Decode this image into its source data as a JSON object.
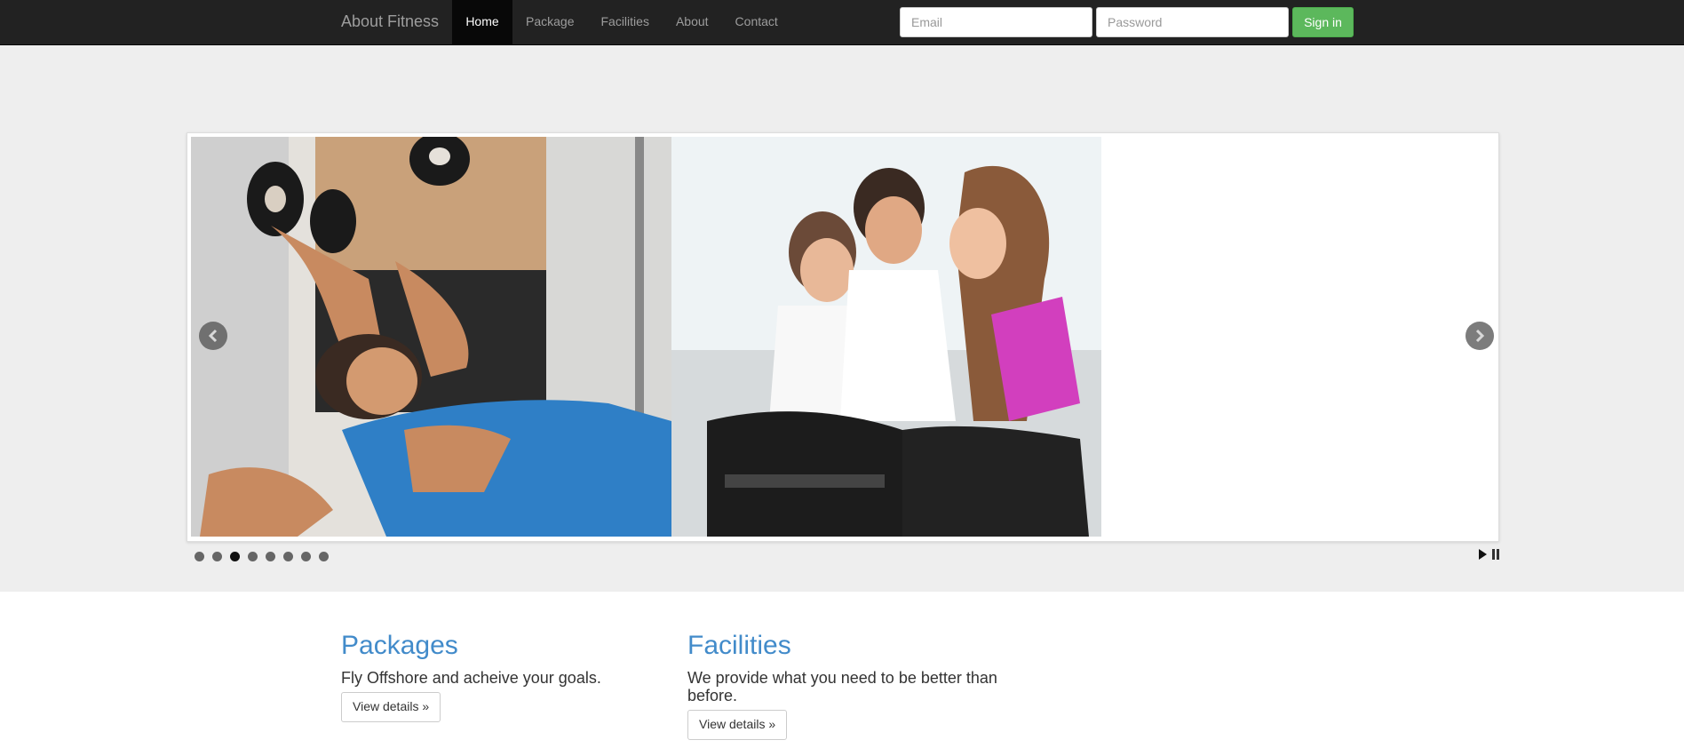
{
  "navbar": {
    "brand": "About Fitness",
    "items": [
      {
        "label": "Home",
        "active": true
      },
      {
        "label": "Package",
        "active": false
      },
      {
        "label": "Facilities",
        "active": false
      },
      {
        "label": "About",
        "active": false
      },
      {
        "label": "Contact",
        "active": false
      }
    ],
    "email_placeholder": "Email",
    "password_placeholder": "Password",
    "signin_label": "Sign in"
  },
  "slider": {
    "slide_count": 8,
    "current_slide": 3,
    "icons": {
      "prev": "chevron-left-icon",
      "next": "chevron-right-icon",
      "play": "play-icon",
      "pause": "pause-icon"
    }
  },
  "columns": [
    {
      "title": "Packages",
      "text": "Fly Offshore and acheive your goals.",
      "button": "View details »"
    },
    {
      "title": "Facilities",
      "text": "We provide what you need to be better than before.",
      "button": "View details »"
    }
  ],
  "colors": {
    "navbar_bg": "#222222",
    "hero_bg": "#eeeeee",
    "link_blue": "#428bca",
    "success_green": "#5cb85c"
  }
}
